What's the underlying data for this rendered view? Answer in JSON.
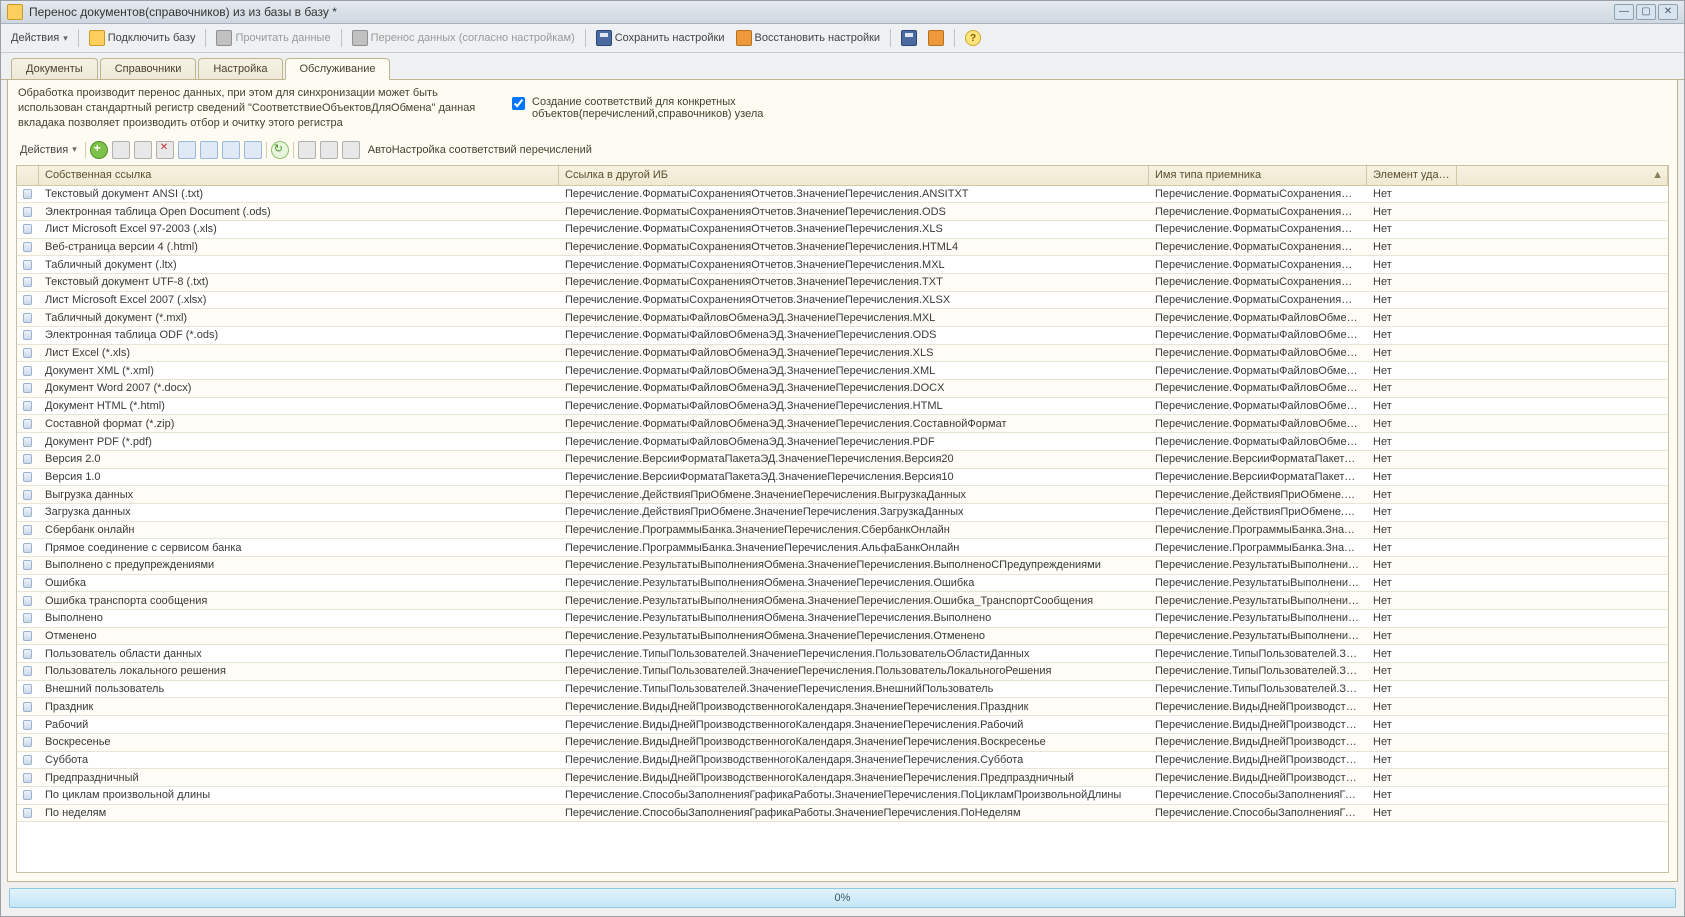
{
  "window": {
    "title": "Перенос документов(справочников) из из базы в базу *"
  },
  "main_toolbar": {
    "actions": "Действия",
    "connect_db": "Подключить базу",
    "read_data": "Прочитать данные",
    "transfer": "Перенос данных (согласно настройкам)",
    "save_settings": "Сохранить настройки",
    "restore_settings": "Восстановить настройки"
  },
  "tabs": {
    "t0": "Документы",
    "t1": "Справочники",
    "t2": "Настройка",
    "t3": "Обслуживание"
  },
  "desc": "Обработка производит перенос данных, при этом для синхронизации может быть использован стандартный регистр сведений \"СоответствиеОбъектовДляОбмена\" данная вкладака позволяет производить отбор и очитку этого регистра",
  "checkbox": {
    "label": "Создание  соответствий для конкретных объектов(перечислений,справочников) узела"
  },
  "inner": {
    "actions": "Действия",
    "auto": "АвтоНастройка соответствий перечислений"
  },
  "grid": {
    "headers": {
      "c1": "Собственная ссылка",
      "c2": "Ссылка в другой ИБ",
      "c3": "Имя типа приемника",
      "c4": "Элемент удален"
    },
    "rows": [
      {
        "c1": "Текстовый документ ANSI (.txt)",
        "c2": "Перечисление.ФорматыСохраненияОтчетов.ЗначениеПеречисления.ANSITXT",
        "c3": "Перечисление.ФорматыСохраненияОтчетов…",
        "c4": "Нет"
      },
      {
        "c1": "Электронная таблица Open Document (.ods)",
        "c2": "Перечисление.ФорматыСохраненияОтчетов.ЗначениеПеречисления.ODS",
        "c3": "Перечисление.ФорматыСохраненияОтчетов…",
        "c4": "Нет"
      },
      {
        "c1": "Лист Microsoft Excel 97-2003 (.xls)",
        "c2": "Перечисление.ФорматыСохраненияОтчетов.ЗначениеПеречисления.XLS",
        "c3": "Перечисление.ФорматыСохраненияОтчетов…",
        "c4": "Нет"
      },
      {
        "c1": "Веб-страница версии 4 (.html)",
        "c2": "Перечисление.ФорматыСохраненияОтчетов.ЗначениеПеречисления.HTML4",
        "c3": "Перечисление.ФорматыСохраненияОтчетов…",
        "c4": "Нет"
      },
      {
        "c1": "Табличный документ (.ltx)",
        "c2": "Перечисление.ФорматыСохраненияОтчетов.ЗначениеПеречисления.MXL",
        "c3": "Перечисление.ФорматыСохраненияОтчетов…",
        "c4": "Нет"
      },
      {
        "c1": "Текстовый документ UTF-8 (.txt)",
        "c2": "Перечисление.ФорматыСохраненияОтчетов.ЗначениеПеречисления.TXT",
        "c3": "Перечисление.ФорматыСохраненияОтчетов…",
        "c4": "Нет"
      },
      {
        "c1": "Лист Microsoft Excel 2007 (.xlsx)",
        "c2": "Перечисление.ФорматыСохраненияОтчетов.ЗначениеПеречисления.XLSX",
        "c3": "Перечисление.ФорматыСохраненияОтчетов…",
        "c4": "Нет"
      },
      {
        "c1": "Табличный документ (*.mxl)",
        "c2": "Перечисление.ФорматыФайловОбменаЭД.ЗначениеПеречисления.MXL",
        "c3": "Перечисление.ФорматыФайловОбменаЭД…",
        "c4": "Нет"
      },
      {
        "c1": "Электронная таблица ODF (*.ods)",
        "c2": "Перечисление.ФорматыФайловОбменаЭД.ЗначениеПеречисления.ODS",
        "c3": "Перечисление.ФорматыФайловОбменаЭД…",
        "c4": "Нет"
      },
      {
        "c1": "Лист Excel (*.xls)",
        "c2": "Перечисление.ФорматыФайловОбменаЭД.ЗначениеПеречисления.XLS",
        "c3": "Перечисление.ФорматыФайловОбменаЭД…",
        "c4": "Нет"
      },
      {
        "c1": "Документ XML (*.xml)",
        "c2": "Перечисление.ФорматыФайловОбменаЭД.ЗначениеПеречисления.XML",
        "c3": "Перечисление.ФорматыФайловОбменаЭД…",
        "c4": "Нет"
      },
      {
        "c1": "Документ Word 2007 (*.docx)",
        "c2": "Перечисление.ФорматыФайловОбменаЭД.ЗначениеПеречисления.DOCX",
        "c3": "Перечисление.ФорматыФайловОбменаЭД…",
        "c4": "Нет"
      },
      {
        "c1": "Документ HTML (*.html)",
        "c2": "Перечисление.ФорматыФайловОбменаЭД.ЗначениеПеречисления.HTML",
        "c3": "Перечисление.ФорматыФайловОбменаЭД…",
        "c4": "Нет"
      },
      {
        "c1": "Составной формат (*.zip)",
        "c2": "Перечисление.ФорматыФайловОбменаЭД.ЗначениеПеречисления.СоставнойФормат",
        "c3": "Перечисление.ФорматыФайловОбменаЭД…",
        "c4": "Нет"
      },
      {
        "c1": "Документ PDF (*.pdf)",
        "c2": "Перечисление.ФорматыФайловОбменаЭД.ЗначениеПеречисления.PDF",
        "c3": "Перечисление.ФорматыФайловОбменаЭД…",
        "c4": "Нет"
      },
      {
        "c1": "Версия 2.0",
        "c2": "Перечисление.ВерсииФорматаПакетаЭД.ЗначениеПеречисления.Версия20",
        "c3": "Перечисление.ВерсииФорматаПакетаЭД.З…",
        "c4": "Нет"
      },
      {
        "c1": "Версия 1.0",
        "c2": "Перечисление.ВерсииФорматаПакетаЭД.ЗначениеПеречисления.Версия10",
        "c3": "Перечисление.ВерсииФорматаПакетаЭД.З…",
        "c4": "Нет"
      },
      {
        "c1": "Выгрузка данных",
        "c2": "Перечисление.ДействияПриОбмене.ЗначениеПеречисления.ВыгрузкаДанных",
        "c3": "Перечисление.ДействияПриОбмене.Значен…",
        "c4": "Нет"
      },
      {
        "c1": "Загрузка данных",
        "c2": "Перечисление.ДействияПриОбмене.ЗначениеПеречисления.ЗагрузкаДанных",
        "c3": "Перечисление.ДействияПриОбмене.Значен…",
        "c4": "Нет"
      },
      {
        "c1": "Сбербанк онлайн",
        "c2": "Перечисление.ПрограммыБанка.ЗначениеПеречисления.СбербанкОнлайн",
        "c3": "Перечисление.ПрограммыБанка.ЗначениеП…",
        "c4": "Нет"
      },
      {
        "c1": "Прямое соединение с сервисом банка",
        "c2": "Перечисление.ПрограммыБанка.ЗначениеПеречисления.АльфаБанкОнлайн",
        "c3": "Перечисление.ПрограммыБанка.ЗначениеП…",
        "c4": "Нет"
      },
      {
        "c1": "Выполнено с предупреждениями",
        "c2": "Перечисление.РезультатыВыполненияОбмена.ЗначениеПеречисления.ВыполненоСПредупреждениями",
        "c3": "Перечисление.РезультатыВыполненияОбме…",
        "c4": "Нет"
      },
      {
        "c1": "Ошибка",
        "c2": "Перечисление.РезультатыВыполненияОбмена.ЗначениеПеречисления.Ошибка",
        "c3": "Перечисление.РезультатыВыполненияОбме…",
        "c4": "Нет"
      },
      {
        "c1": "Ошибка транспорта сообщения",
        "c2": "Перечисление.РезультатыВыполненияОбмена.ЗначениеПеречисления.Ошибка_ТранспортСообщения",
        "c3": "Перечисление.РезультатыВыполненияОбме…",
        "c4": "Нет"
      },
      {
        "c1": "Выполнено",
        "c2": "Перечисление.РезультатыВыполненияОбмена.ЗначениеПеречисления.Выполнено",
        "c3": "Перечисление.РезультатыВыполненияОбме…",
        "c4": "Нет"
      },
      {
        "c1": "Отменено",
        "c2": "Перечисление.РезультатыВыполненияОбмена.ЗначениеПеречисления.Отменено",
        "c3": "Перечисление.РезультатыВыполненияОбме…",
        "c4": "Нет"
      },
      {
        "c1": "Пользователь области данных",
        "c2": "Перечисление.ТипыПользователей.ЗначениеПеречисления.ПользовательОбластиДанных",
        "c3": "Перечисление.ТипыПользователей.Значени…",
        "c4": "Нет"
      },
      {
        "c1": "Пользователь локального решения",
        "c2": "Перечисление.ТипыПользователей.ЗначениеПеречисления.ПользовательЛокальногоРешения",
        "c3": "Перечисление.ТипыПользователей.Значени…",
        "c4": "Нет"
      },
      {
        "c1": "Внешний пользователь",
        "c2": "Перечисление.ТипыПользователей.ЗначениеПеречисления.ВнешнийПользователь",
        "c3": "Перечисление.ТипыПользователей.Значени…",
        "c4": "Нет"
      },
      {
        "c1": "Праздник",
        "c2": "Перечисление.ВидыДнейПроизводственногоКалендаря.ЗначениеПеречисления.Праздник",
        "c3": "Перечисление.ВидыДнейПроизводственног…",
        "c4": "Нет"
      },
      {
        "c1": "Рабочий",
        "c2": "Перечисление.ВидыДнейПроизводственногоКалендаря.ЗначениеПеречисления.Рабочий",
        "c3": "Перечисление.ВидыДнейПроизводственног…",
        "c4": "Нет"
      },
      {
        "c1": "Воскресенье",
        "c2": "Перечисление.ВидыДнейПроизводственногоКалендаря.ЗначениеПеречисления.Воскресенье",
        "c3": "Перечисление.ВидыДнейПроизводственног…",
        "c4": "Нет"
      },
      {
        "c1": "Суббота",
        "c2": "Перечисление.ВидыДнейПроизводственногоКалендаря.ЗначениеПеречисления.Суббота",
        "c3": "Перечисление.ВидыДнейПроизводственног…",
        "c4": "Нет"
      },
      {
        "c1": "Предпраздничный",
        "c2": "Перечисление.ВидыДнейПроизводственногоКалендаря.ЗначениеПеречисления.Предпраздничный",
        "c3": "Перечисление.ВидыДнейПроизводственног…",
        "c4": "Нет"
      },
      {
        "c1": "По циклам произвольной длины",
        "c2": "Перечисление.СпособыЗаполненияГрафикаРаботы.ЗначениеПеречисления.ПоЦикламПроизвольнойДлины",
        "c3": "Перечисление.СпособыЗаполненияГрафика…",
        "c4": "Нет"
      },
      {
        "c1": "По неделям",
        "c2": "Перечисление.СпособыЗаполненияГрафикаРаботы.ЗначениеПеречисления.ПоНеделям",
        "c3": "Перечисление.СпособыЗаполненияГрафика…",
        "c4": "Нет"
      }
    ]
  },
  "progress": {
    "label": "0%"
  }
}
